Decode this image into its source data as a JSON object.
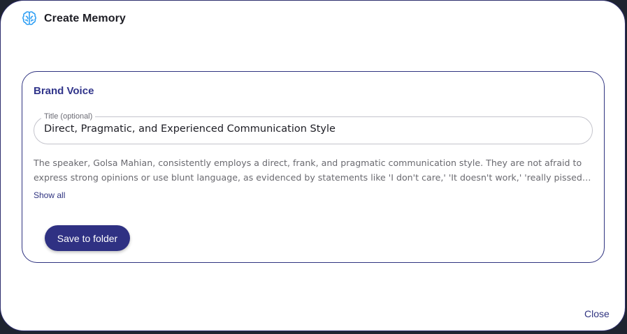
{
  "dialog": {
    "title": "Create Memory",
    "icon": "brain-icon",
    "icon_color": "#2a9df4",
    "close_label": "Close"
  },
  "card": {
    "heading": "Brand Voice",
    "title_field": {
      "label": "Title (optional)",
      "value": "Direct, Pragmatic, and Experienced Communication Style"
    },
    "description_lines": [
      "The speaker, Golsa Mahian, consistently employs a direct, frank, and pragmatic communication style. They are not afraid to",
      "express strong opinions or use blunt language, as evidenced by statements like 'I don't care,' 'It doesn't work,' 'really pissed…"
    ],
    "show_all_label": "Show all",
    "save_label": "Save to folder"
  },
  "colors": {
    "accent": "#2f3183",
    "text_dark": "#1d1d24",
    "text_muted": "#6a6a70"
  }
}
